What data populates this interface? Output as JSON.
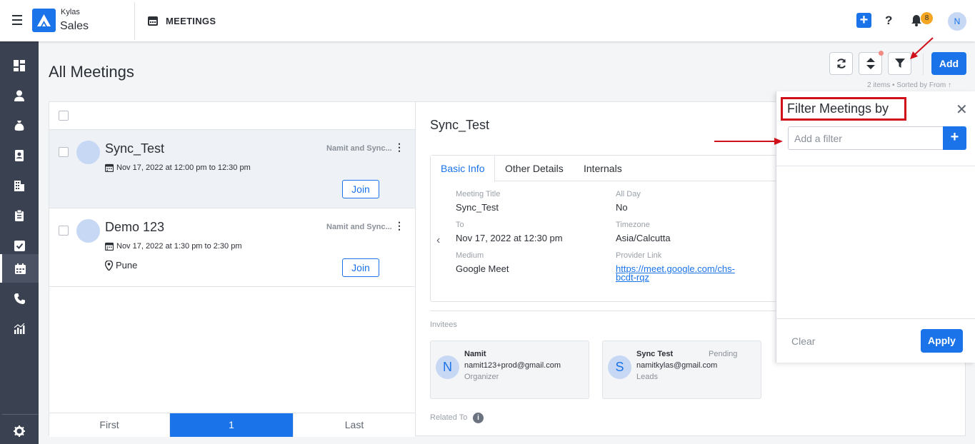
{
  "header": {
    "brand_small": "Kylas",
    "brand_big": "Sales",
    "module_title": "MEETINGS",
    "notification_count": "8",
    "user_initial": "N"
  },
  "page": {
    "title": "All Meetings",
    "add_label": "Add",
    "items_info": "2 items • Sorted by From ↑"
  },
  "list": {
    "meetings": [
      {
        "title": "Sync_Test",
        "owner": "Namit and Sync...",
        "time": "Nov 17, 2022 at 12:00 pm to 12:30 pm",
        "join_label": "Join"
      },
      {
        "title": "Demo 123",
        "owner": "Namit and Sync...",
        "time": "Nov 17, 2022 at 1:30 pm to 2:30 pm",
        "location": "Pune",
        "join_label": "Join"
      }
    ],
    "pager": {
      "first": "First",
      "current": "1",
      "last": "Last"
    }
  },
  "detail": {
    "title": "Sync_Test",
    "tabs": [
      "Basic Info",
      "Other Details",
      "Internals"
    ],
    "fields": {
      "meeting_title_label": "Meeting Title",
      "meeting_title_value": "Sync_Test",
      "all_day_label": "All Day",
      "all_day_value": "No",
      "to_label": "To",
      "to_value": "Nov 17, 2022 at 12:30 pm",
      "timezone_label": "Timezone",
      "timezone_value": "Asia/Calcutta",
      "medium_label": "Medium",
      "medium_value": "Google Meet",
      "provider_link_label": "Provider Link",
      "provider_link_value": "https://meet.google.com/chs-bcdt-rqz"
    },
    "invitees_label": "Invitees",
    "invitees": [
      {
        "initial": "N",
        "name": "Namit",
        "email": "namit123+prod@gmail.com",
        "role": "Organizer",
        "status": ""
      },
      {
        "initial": "S",
        "name": "Sync Test",
        "email": "namitkylas@gmail.com",
        "role": "Leads",
        "status": "Pending"
      }
    ],
    "related_to_label": "Related To"
  },
  "filter": {
    "title": "Filter Meetings by",
    "input_placeholder": "Add a filter",
    "clear_label": "Clear",
    "apply_label": "Apply"
  },
  "colors": {
    "accent": "#1a73e8",
    "sidebar": "#3a4150",
    "highlight_box": "#d0101a",
    "badge": "#f5a623"
  }
}
